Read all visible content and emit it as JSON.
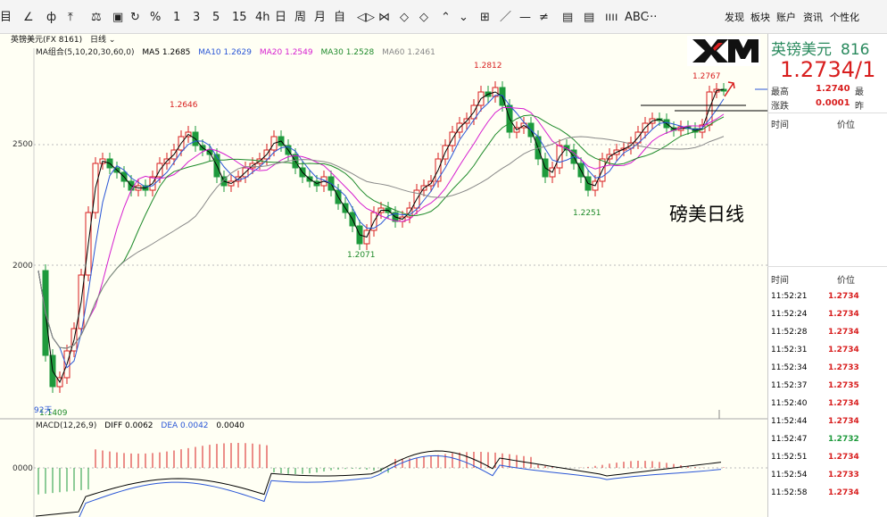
{
  "toolbar": {
    "tools": [
      "目",
      "∠",
      "ф",
      "⤒",
      "⚖",
      "▣",
      "↻",
      "%",
      "1",
      "3",
      "5",
      "15",
      "4h",
      "日",
      "周",
      "月",
      "自",
      "◁▷",
      "⋈",
      "◇",
      "◇",
      "⌃",
      "⌄",
      "⊞",
      "／",
      "—",
      "≠",
      "▤",
      "▤",
      "ıııı",
      "ABC",
      "···"
    ],
    "menu": [
      "发现",
      "板块",
      "账户",
      "资讯",
      "个性化"
    ]
  },
  "header": {
    "instrument": "英镑美元(FX 8161)",
    "period": "日线",
    "ma_group": "MA组合(5,10,20,30,60,0)",
    "ma5": "MA5 1.2685",
    "ma10": "MA10 1.2629",
    "ma20": "MA20 1.2549",
    "ma30": "MA30 1.2528",
    "ma60": "MA60 1.2461"
  },
  "colors": {
    "up": "#d81e1e",
    "down": "#1e9a3c",
    "ma5": "#000000",
    "ma10": "#2a56d6",
    "ma20": "#d61ecf",
    "ma30": "#1e8a2a",
    "ma60": "#888888",
    "diff": "#000000",
    "dea": "#2a56d6"
  },
  "chart_data": {
    "type": "candlestick",
    "axis_labels": [
      "2500",
      "2000",
      "0000"
    ],
    "price_labels": {
      "high1": "1.2646",
      "low1": "1.2071",
      "high2": "1.2812",
      "low2": "1.2251",
      "high3": "1.2767",
      "start_low": "1.1409",
      "start_days": "92天"
    },
    "annotation": "磅美日线",
    "macd": {
      "label": "MACD(12,26,9)",
      "diff": "DIFF 0.0062",
      "dea": "DEA 0.0042",
      "macd": "0.0040"
    }
  },
  "quote": {
    "name": "英镑美元",
    "code": "816",
    "price": "1.2734/1",
    "high_label": "最高",
    "high_value": "1.2740",
    "change_label": "涨跌",
    "change_value": "0.0001",
    "extra1": "最",
    "extra2": "昨"
  },
  "trades_header": {
    "time": "时间",
    "price": "价位"
  },
  "trades": [
    {
      "time": "11:52:21",
      "price": "1.2734",
      "dir": "up"
    },
    {
      "time": "11:52:24",
      "price": "1.2734",
      "dir": "up"
    },
    {
      "time": "11:52:28",
      "price": "1.2734",
      "dir": "up"
    },
    {
      "time": "11:52:31",
      "price": "1.2734",
      "dir": "up"
    },
    {
      "time": "11:52:34",
      "price": "1.2733",
      "dir": "up"
    },
    {
      "time": "11:52:37",
      "price": "1.2735",
      "dir": "up"
    },
    {
      "time": "11:52:40",
      "price": "1.2734",
      "dir": "up"
    },
    {
      "time": "11:52:44",
      "price": "1.2734",
      "dir": "up"
    },
    {
      "time": "11:52:47",
      "price": "1.2732",
      "dir": "down"
    },
    {
      "time": "11:52:51",
      "price": "1.2734",
      "dir": "up"
    },
    {
      "time": "11:52:54",
      "price": "1.2733",
      "dir": "up"
    },
    {
      "time": "11:52:58",
      "price": "1.2734",
      "dir": "up"
    }
  ]
}
